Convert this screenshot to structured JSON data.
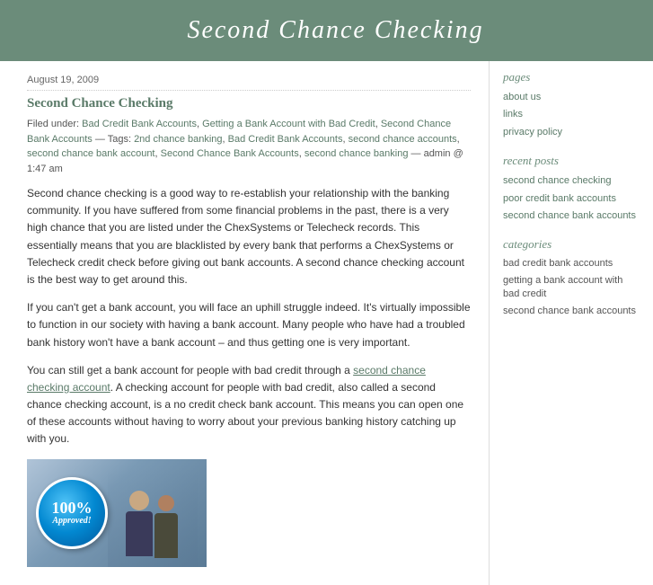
{
  "header": {
    "title": "Second Chance Checking"
  },
  "post": {
    "date": "August 19, 2009",
    "title": "Second Chance Checking",
    "meta_filed": "Filed under:",
    "tags_label": "Tags:",
    "admin": "— admin @ 1:47 am",
    "tags": [
      "Bad Credit Bank Accounts",
      "Getting a Bank Account with Bad Credit",
      "Second Chance Bank Accounts",
      "2nd chance banking",
      "Bad Credit Bank Accounts",
      "second chance accounts",
      "second chance bank account",
      "Second Chance Bank Accounts",
      "second chance banking"
    ],
    "paragraphs": [
      "Second chance checking is a good way to re-establish your relationship with the banking community. If you have suffered from some financial problems in the past, there is a very high chance that you are listed under the ChexSystems or Telecheck records. This essentially means that you are blacklisted by every bank that performs a ChexSystems or Telecheck credit check before giving out bank accounts. A second chance checking account is the best way to get around this.",
      "If you can't get a bank account, you will face an uphill struggle indeed. It's virtually impossible to function in our society with having a bank account. Many people who have had a troubled bank history won't have a bank account – and thus getting one is very important.",
      "You can still get a bank account for people with bad credit through a second chance checking account. A checking account for people with bad credit, also called a second chance checking account, is a no credit check bank account. This means you can open one of these accounts without having to worry about your previous banking history catching up with you."
    ],
    "link_text": "second chance checking account"
  },
  "sidebar": {
    "pages_title": "pages",
    "pages": [
      {
        "label": "about us"
      },
      {
        "label": "links"
      },
      {
        "label": "privacy policy"
      }
    ],
    "recent_title": "recent posts",
    "recent": [
      {
        "label": "second chance checking"
      },
      {
        "label": "poor credit bank accounts"
      },
      {
        "label": "second chance bank accounts"
      }
    ],
    "categories_title": "categories",
    "categories": [
      {
        "label": "bad credit bank accounts"
      },
      {
        "label": "getting a bank account with bad credit"
      },
      {
        "label": "second chance bank accounts"
      }
    ]
  },
  "badge": {
    "pct": "100%",
    "word": "Approved!"
  }
}
